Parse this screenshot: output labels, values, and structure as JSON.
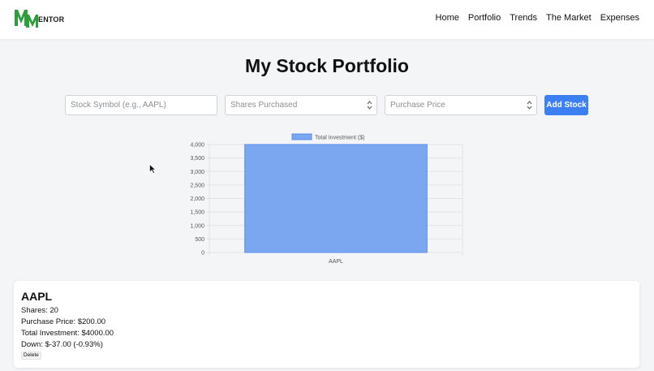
{
  "nav": {
    "logo_text": "ENTOR",
    "links": [
      "Home",
      "Portfolio",
      "Trends",
      "The Market",
      "Expenses"
    ]
  },
  "page": {
    "title": "My Stock Portfolio"
  },
  "form": {
    "symbol_placeholder": "Stock Symbol (e.g., AAPL)",
    "shares_placeholder": "Shares Purchased",
    "price_placeholder": "Purchase Price",
    "add_label": "Add Stock"
  },
  "chart_data": {
    "type": "bar",
    "categories": [
      "AAPL"
    ],
    "series": [
      {
        "name": "Total Investment ($)",
        "values": [
          4000
        ]
      }
    ],
    "ylim": [
      0,
      4000
    ],
    "yticks": [
      "4,000",
      "3,500",
      "3,000",
      "2,500",
      "2,000",
      "1,500",
      "1,000",
      "500",
      "0"
    ],
    "legend": "top",
    "grid": true,
    "colors": {
      "bar": "#7ba6f0",
      "bar_border": "#5b8de8"
    }
  },
  "stock_card": {
    "symbol": "AAPL",
    "shares": "Shares: 20",
    "purchase_price": "Purchase Price: $200.00",
    "total_investment": "Total Investment: $4000.00",
    "change": "Down: $-37.00 (-0.93%)",
    "delete_label": "Delete"
  },
  "colors": {
    "accent": "#3b7ff2",
    "logo_green": "#2e9e3c"
  }
}
